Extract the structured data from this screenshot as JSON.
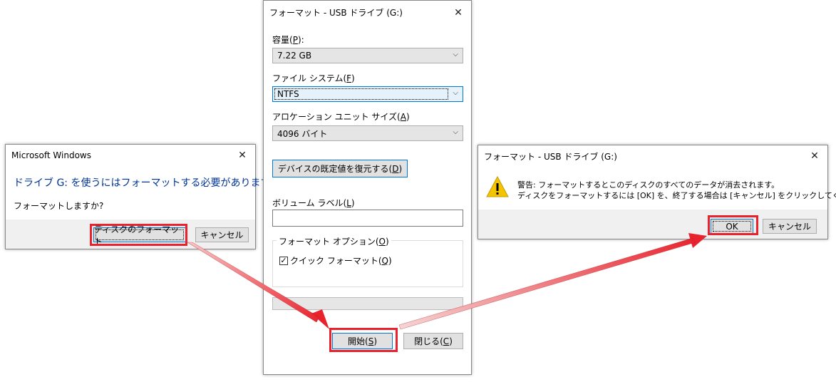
{
  "left_dialog": {
    "title": "Microsoft Windows",
    "heading": "ドライブ G: を使うにはフォーマットする必要があります。",
    "question": "フォーマットしますか?",
    "format_button": "ディスクのフォーマット",
    "cancel_button": "キャンセル"
  },
  "center_dialog": {
    "title": "フォーマット - USB ドライブ (G:)",
    "capacity_label": "容量(",
    "capacity_key": "P",
    "capacity_tail": "):",
    "capacity_value": "7.22 GB",
    "filesystem_label": "ファイル システム(",
    "filesystem_key": "F",
    "filesystem_tail": ")",
    "filesystem_value": "NTFS",
    "alloc_label": "アロケーション ユニット サイズ(",
    "alloc_key": "A",
    "alloc_tail": ")",
    "alloc_value": "4096 バイト",
    "restore_label": "デバイスの既定値を復元する(",
    "restore_key": "D",
    "restore_tail": ")",
    "volume_label": "ボリューム ラベル(",
    "volume_key": "L",
    "volume_tail": ")",
    "volume_value": "",
    "options_label": "フォーマット オプション(",
    "options_key": "O",
    "options_tail": ")",
    "quick_label": "クイック フォーマット(",
    "quick_key": "Q",
    "quick_tail": ")",
    "quick_checked": true,
    "start_label": "開始(",
    "start_key": "S",
    "start_tail": ")",
    "close_label": "閉じる(",
    "close_key": "C",
    "close_tail": ")"
  },
  "right_dialog": {
    "title": "フォーマット - USB ドライブ (G:)",
    "warning_line1": "警告: フォーマットするとこのディスクのすべてのデータが消去されます。",
    "warning_line2": "ディスクをフォーマットするには [OK] を、終了する場合は [キャンセル] をクリックしてください。",
    "ok_button": "OK",
    "cancel_button": "キャンセル"
  },
  "icons": {
    "close": "close-icon",
    "warning": "warning-icon",
    "chevron": "chevron-down-icon",
    "checkbox": "checkbox-icon",
    "arrow": "arrow-icon"
  },
  "colors": {
    "highlight": "#e8232e",
    "heading_blue": "#003399",
    "focus_blue": "#0078d7",
    "warning_yellow": "#f5c400"
  }
}
